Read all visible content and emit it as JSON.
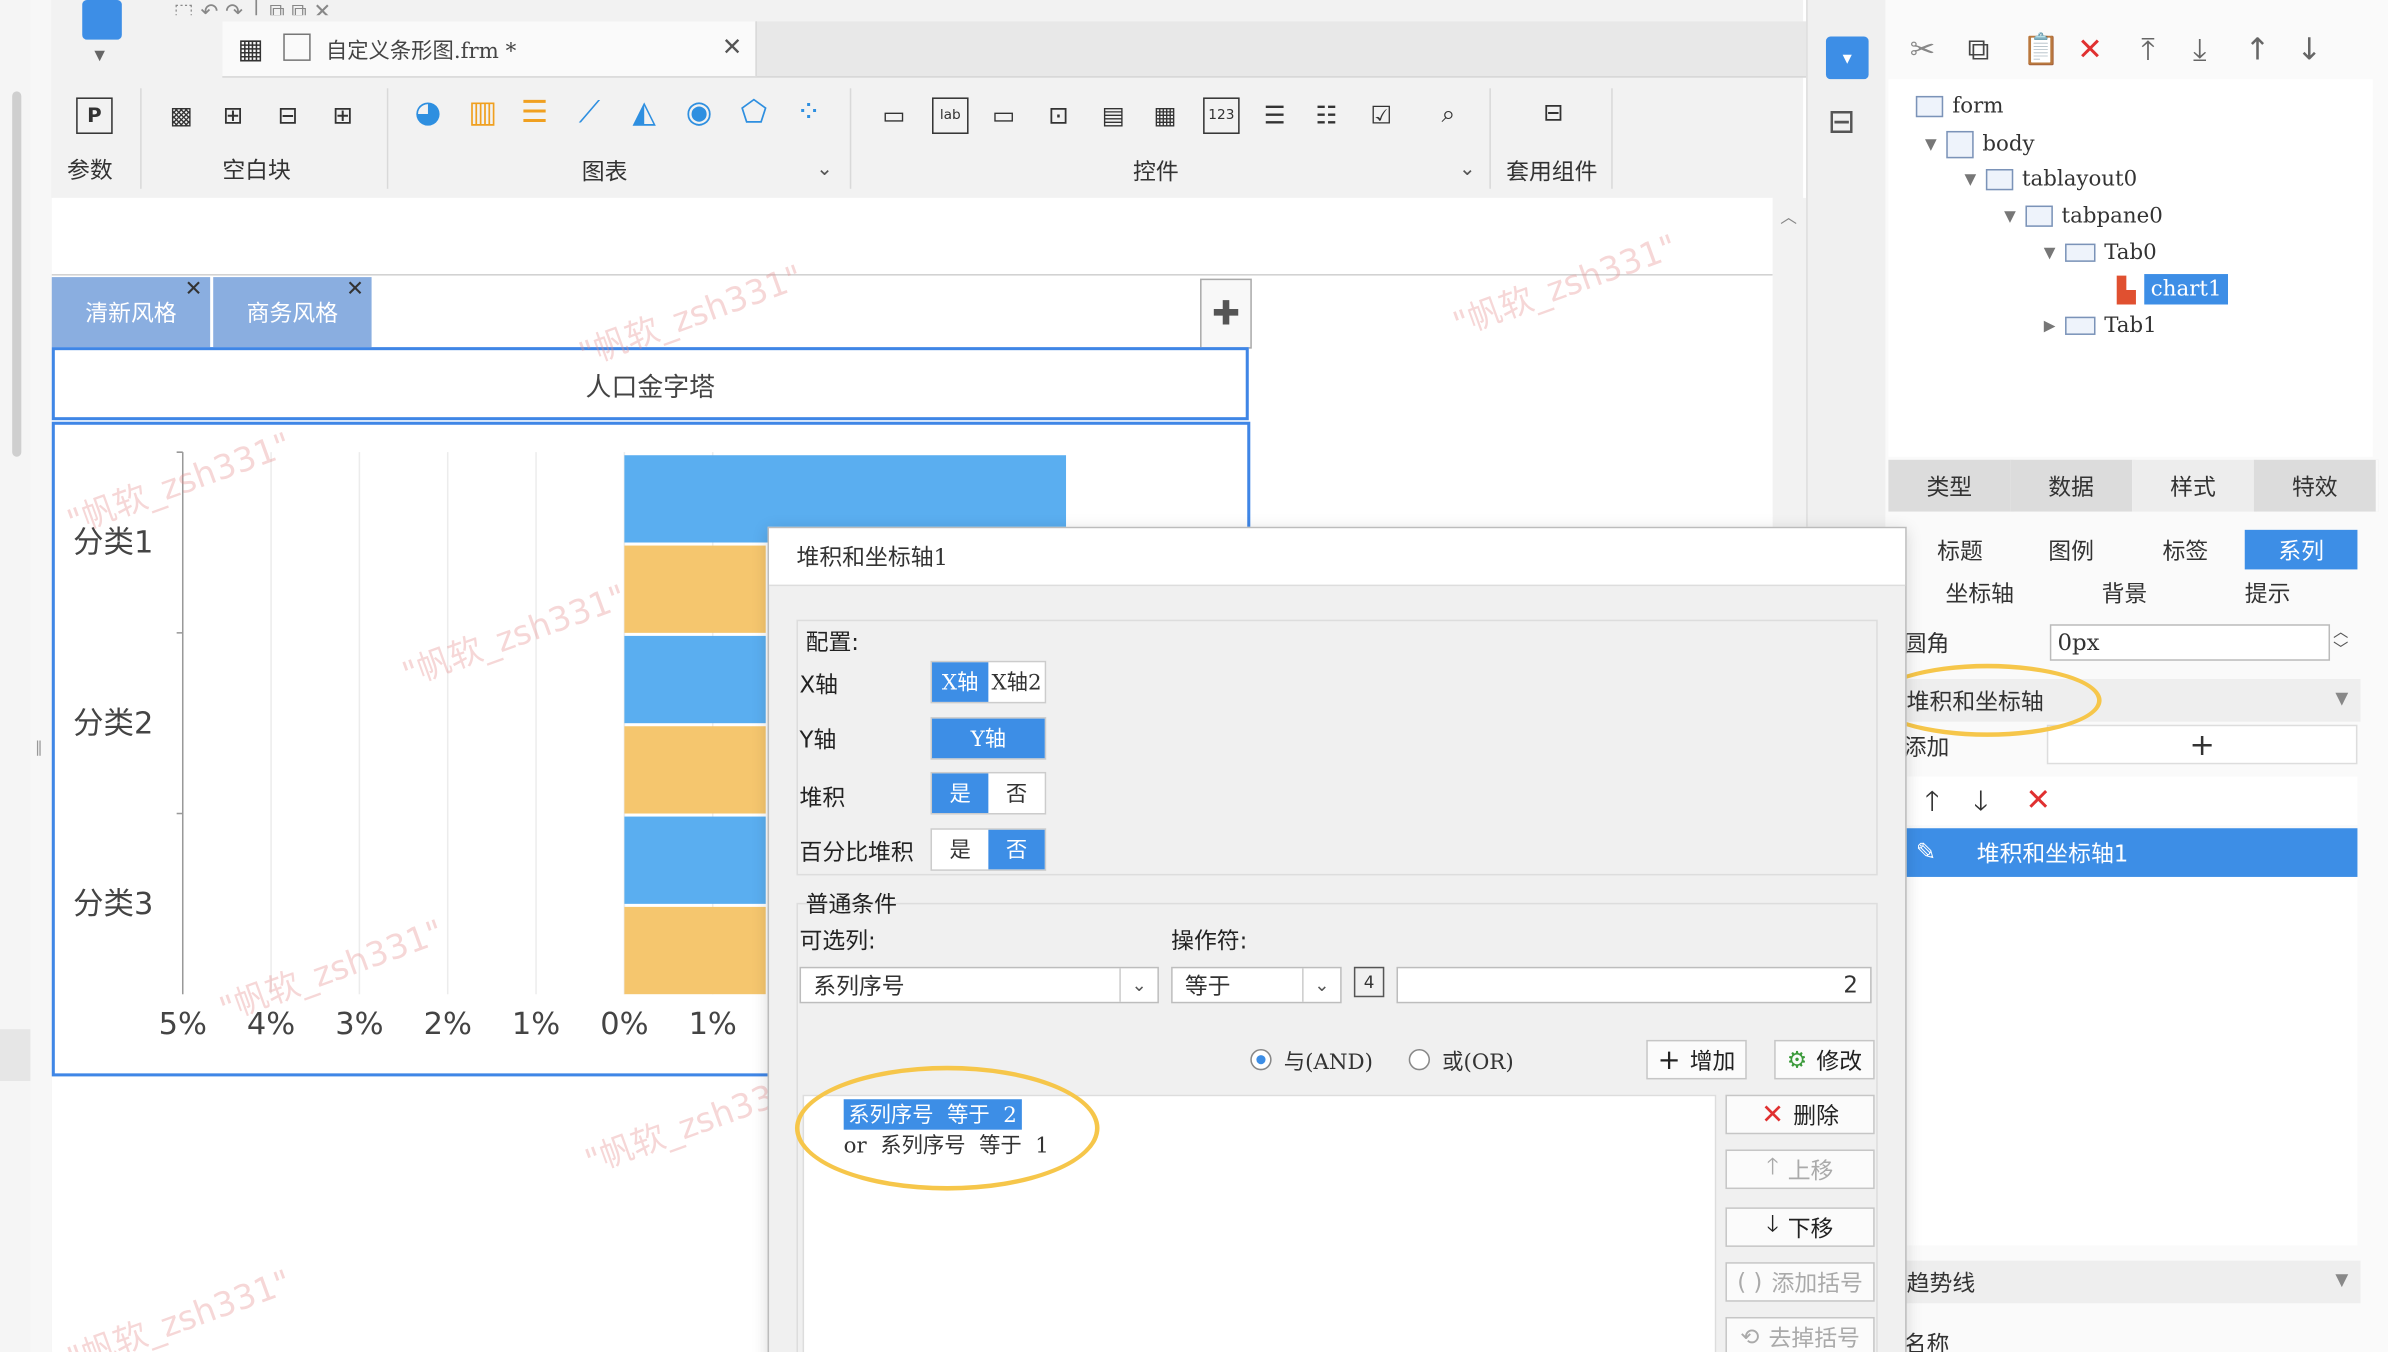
{
  "editor": {
    "file_tab": "自定义条形图.frm *",
    "toolbar_groups": {
      "param": "参数",
      "blank": "空白块",
      "chart": "图表",
      "widget": "控件",
      "template": "套用组件"
    }
  },
  "style_tabs": [
    {
      "label": "清新风格"
    },
    {
      "label": "商务风格"
    }
  ],
  "chart": {
    "title": "人口金字塔"
  },
  "watermark": "\"帆软_zsh331\"",
  "chart_data": {
    "type": "bar",
    "orientation": "horizontal",
    "categories": [
      "分类1",
      "分类2",
      "分类3"
    ],
    "x_tick_labels": [
      "5%",
      "4%",
      "3%",
      "2%",
      "1%",
      "0%",
      "1%"
    ],
    "series": [
      {
        "color": "#5aaef0",
        "values": [
          5,
          1.6,
          1.6
        ]
      },
      {
        "color": "#f5c66e",
        "values": [
          1.6,
          1.6,
          1.6
        ]
      }
    ],
    "grid": true
  },
  "tree": {
    "items": [
      "form",
      "body",
      "tablayout0",
      "tabpane0",
      "Tab0",
      "chart1",
      "Tab1"
    ]
  },
  "prop_tabs": [
    "类型",
    "数据",
    "样式",
    "特效"
  ],
  "sub_tabs_row1": [
    "标题",
    "图例",
    "标签",
    "系列"
  ],
  "sub_tabs_row2": [
    "坐标轴",
    "背景",
    "提示"
  ],
  "props": {
    "radius_label": "圆角",
    "radius_value": "0px",
    "stack_section": "堆积和坐标轴",
    "add_label": "添加",
    "stack_item": "堆积和坐标轴1",
    "trend_section": "趋势线",
    "name_label": "名称"
  },
  "dialog": {
    "title": "堆积和坐标轴1",
    "config_label": "配置:",
    "xaxis_label": "X轴",
    "xaxis_options": [
      "X轴",
      "X轴2"
    ],
    "yaxis_label": "Y轴",
    "yaxis_option": "Y轴",
    "stack_label": "堆积",
    "percent_label": "百分比堆积",
    "yes": "是",
    "no": "否",
    "cond_label": "普通条件",
    "col_label": "可选列:",
    "op_label": "操作符:",
    "col_value": "系列序号",
    "op_value": "等于",
    "op_badge": "4",
    "cond_value": "2",
    "and_label": "与(AND)",
    "or_label": "或(OR)",
    "add_btn": "增加",
    "modify_btn": "修改",
    "delete_btn": "删除",
    "up_btn": "上移",
    "down_btn": "下移",
    "add_bracket_btn": "添加括号",
    "remove_bracket_btn": "去掉括号",
    "conditions": [
      "系列序号  等于  2",
      "or  系列序号  等于  1"
    ]
  }
}
